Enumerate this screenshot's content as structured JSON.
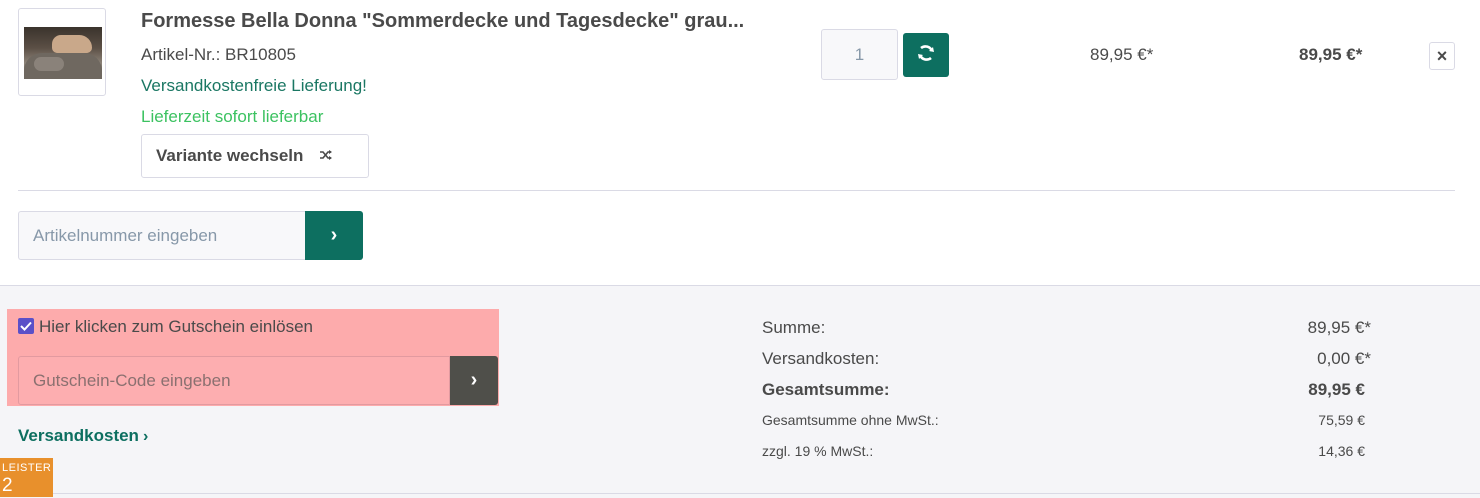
{
  "product": {
    "title": "Formesse Bella Donna \"Sommerdecke und Tagesdecke\" grau...",
    "article_number": "Artikel-Nr.: BR10805",
    "shipping_note": "Versandkostenfreie Lieferung!",
    "delivery_time": "Lieferzeit sofort lieferbar",
    "variant_button": "Variante wechseln",
    "quantity": "1",
    "unit_price": "89,95 €*",
    "total_price": "89,95 €*",
    "remove_label": "×"
  },
  "add_article": {
    "placeholder": "Artikelnummer eingeben",
    "button_label": "›"
  },
  "coupon": {
    "checkbox_label": "Hier klicken zum Gutschein einlösen",
    "checked": true,
    "placeholder": "Gutschein-Code eingeben",
    "button_label": "›"
  },
  "shipping_link": {
    "label": "Versandkosten",
    "chevron": "›"
  },
  "summary": [
    {
      "label": "Summe:",
      "value": "89,95 €*"
    },
    {
      "label": "Versandkosten:",
      "value": "0,00 €*"
    },
    {
      "label": "Gesamtsumme:",
      "value": "89,95 €"
    },
    {
      "label": "Gesamtsumme ohne MwSt.:",
      "value": "75,59 €"
    },
    {
      "label": "zzgl. 19 % MwSt.:",
      "value": "14,36 €"
    }
  ],
  "badge": {
    "line1": "LEISTER",
    "line2": "2"
  },
  "colors": {
    "accent": "#0d6f60",
    "highlight": "#fdabac",
    "badge": "#e8902c",
    "checkbox": "#5b50c8"
  },
  "icons": {
    "refresh": "refresh-icon",
    "shuffle": "shuffle-icon",
    "close": "close-icon"
  }
}
